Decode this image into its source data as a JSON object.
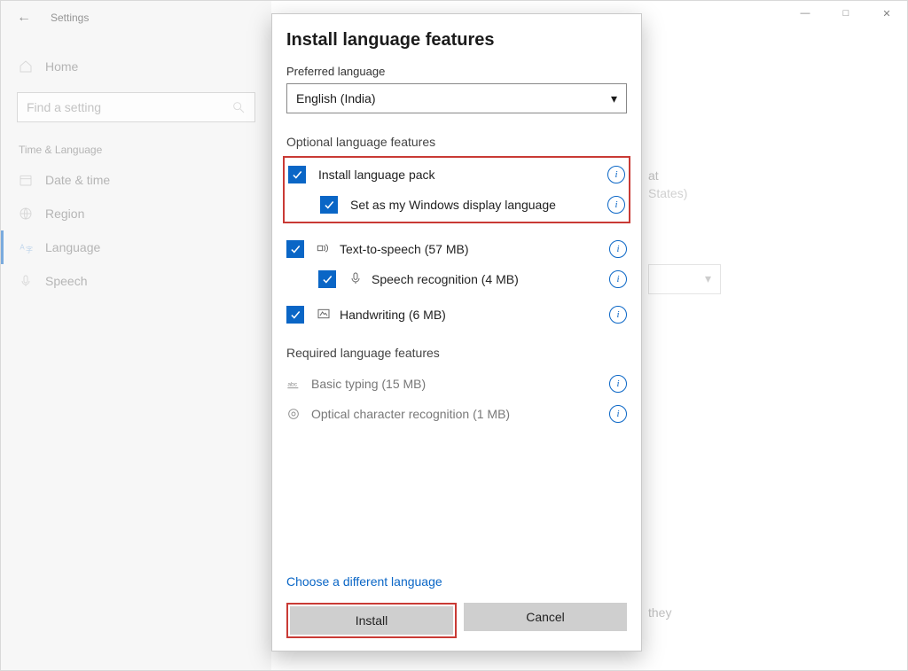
{
  "window": {
    "app": "Settings"
  },
  "sidebar": {
    "home": "Home",
    "search_placeholder": "Find a setting",
    "section": "Time & Language",
    "items": [
      "Date & time",
      "Region",
      "Language",
      "Speech"
    ]
  },
  "modal": {
    "title": "Install language features",
    "preferred_label": "Preferred language",
    "preferred_value": "English (India)",
    "optional_label": "Optional language features",
    "features": {
      "install_pack": "Install language pack",
      "set_display": "Set as my Windows display language",
      "tts": "Text-to-speech (57 MB)",
      "speech_rec": "Speech recognition (4 MB)",
      "handwriting": "Handwriting (6 MB)"
    },
    "required_label": "Required language features",
    "required": {
      "basic": "Basic typing (15 MB)",
      "ocr": "Optical character recognition (1 MB)"
    },
    "choose_link": "Choose a different language",
    "install": "Install",
    "cancel": "Cancel"
  },
  "bg_right": {
    "line1": "at",
    "line2": "States)",
    "line3": "they"
  }
}
